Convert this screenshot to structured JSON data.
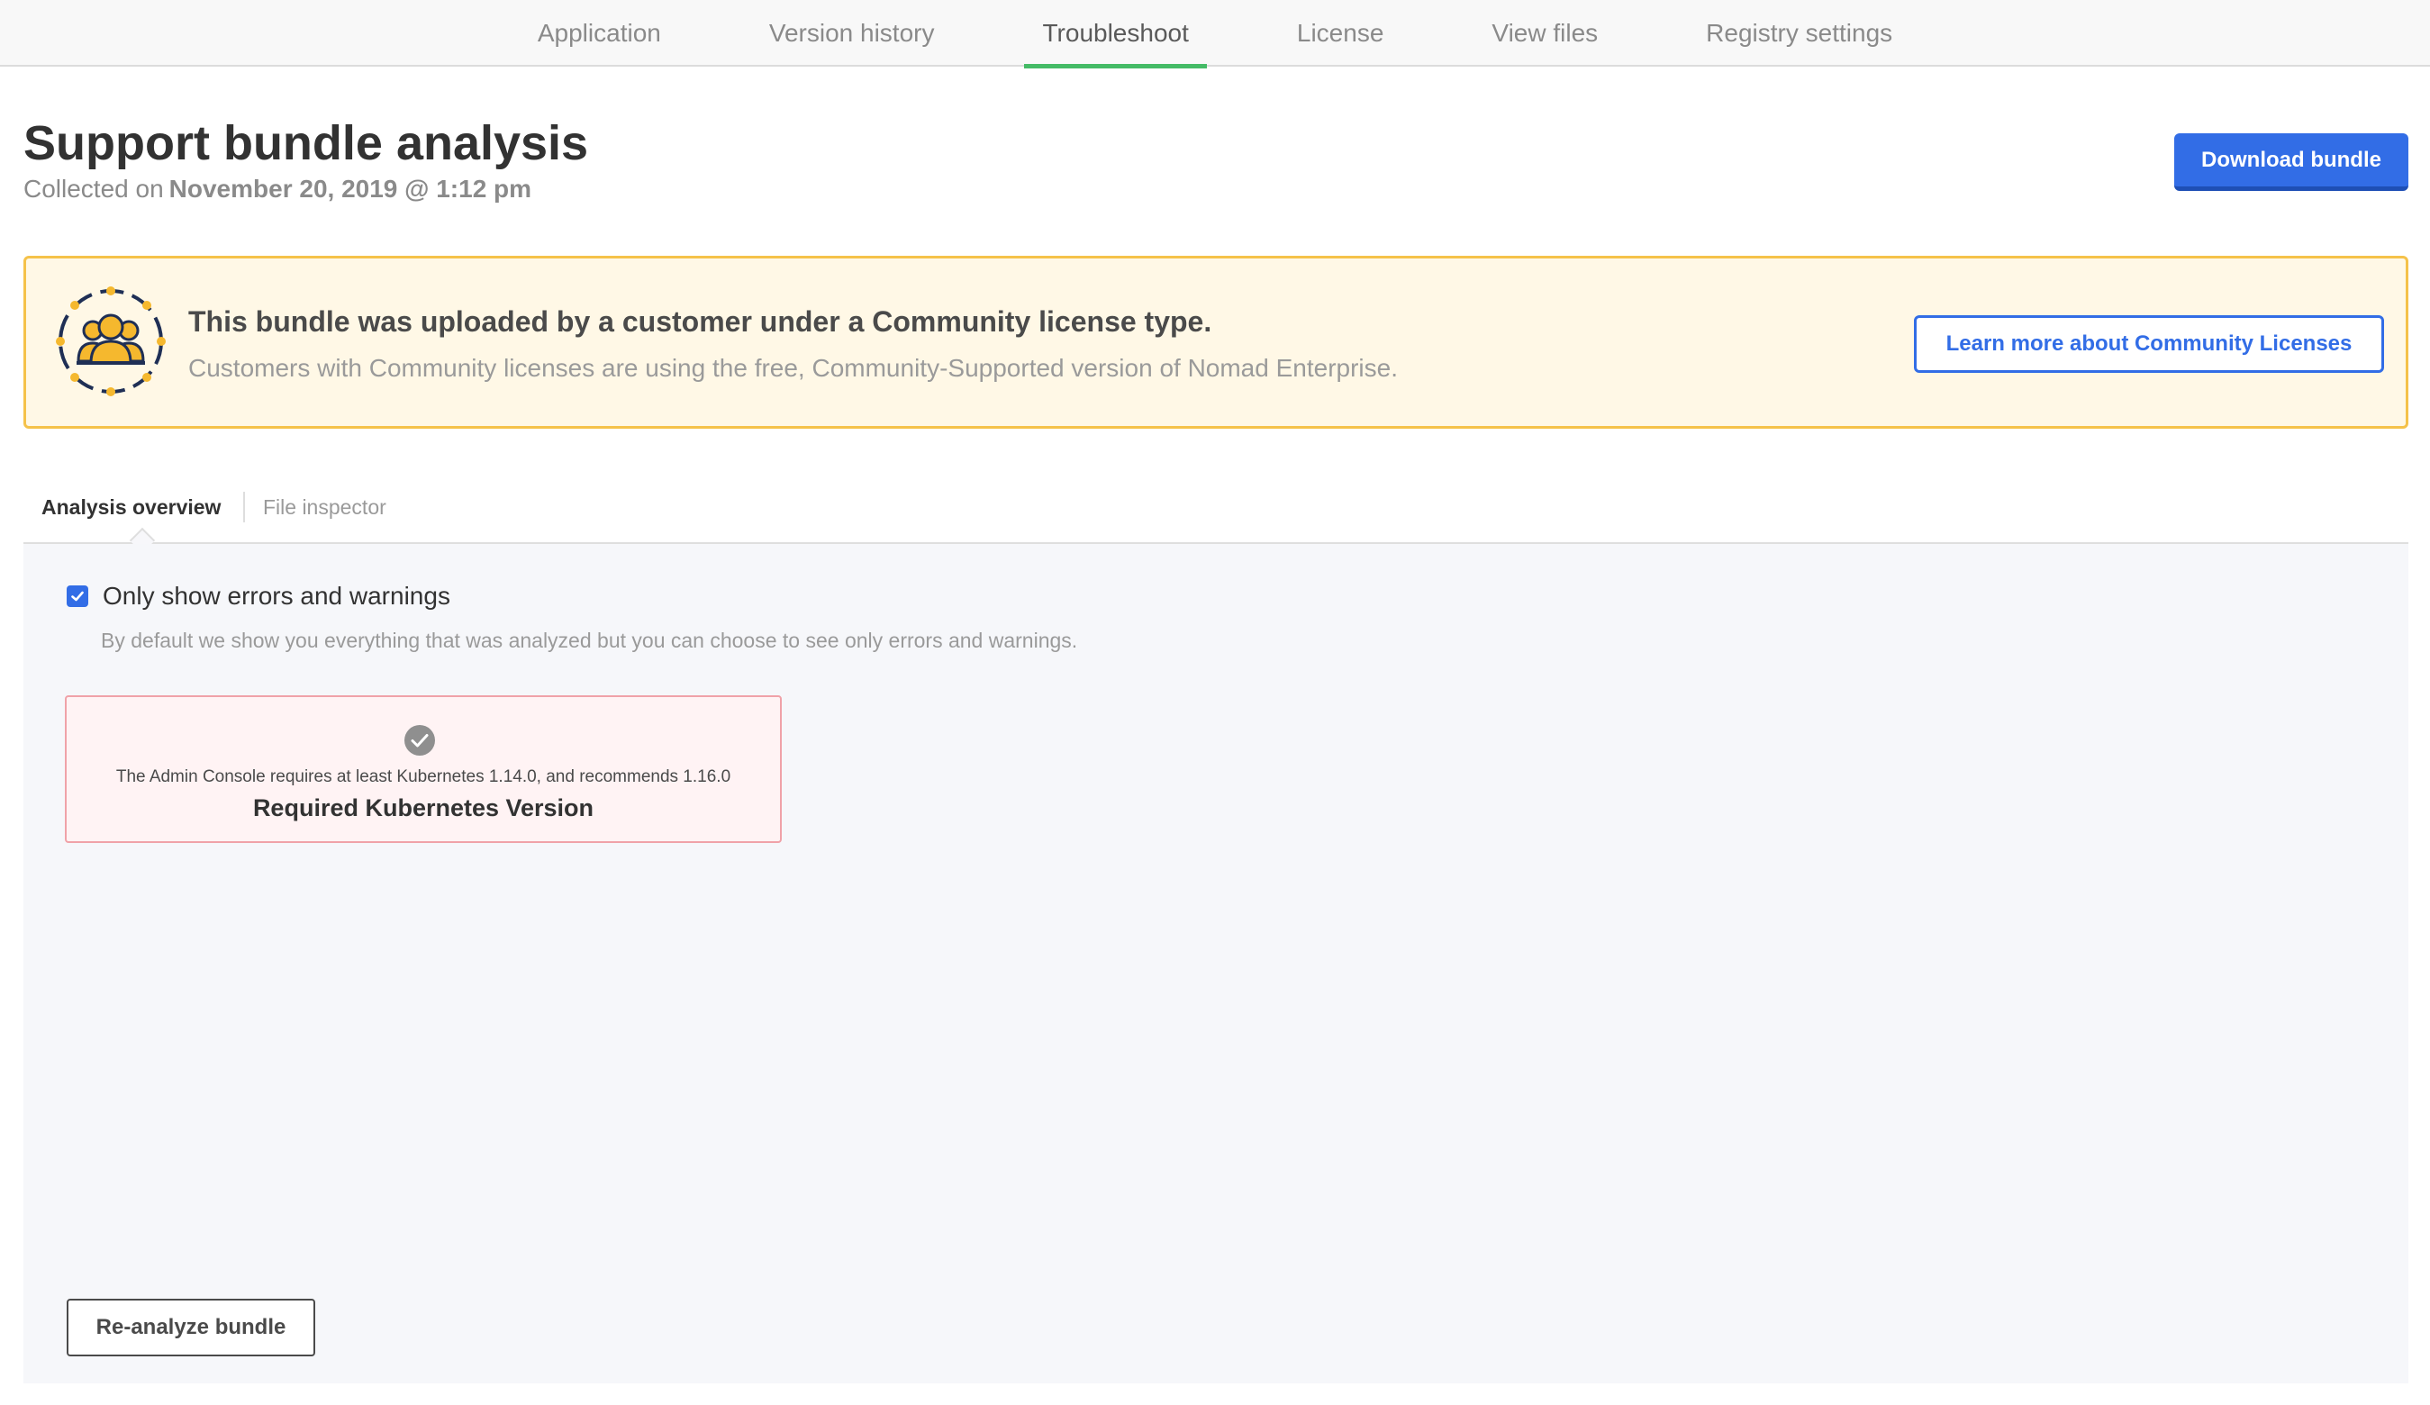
{
  "nav": {
    "tabs": [
      {
        "label": "Application"
      },
      {
        "label": "Version history"
      },
      {
        "label": "Troubleshoot"
      },
      {
        "label": "License"
      },
      {
        "label": "View files"
      },
      {
        "label": "Registry settings"
      }
    ],
    "active_tab": "Troubleshoot"
  },
  "header": {
    "title": "Support bundle analysis",
    "collected_prefix": "Collected on",
    "collected_date": "November 20, 2019 @ 1:12 pm",
    "download_label": "Download bundle"
  },
  "banner": {
    "icon": "community-users-icon",
    "title": "This bundle was uploaded by a customer under a Community license type.",
    "subtitle": "Customers with Community licenses are using the free, Community-Supported version of Nomad Enterprise.",
    "learn_more_label": "Learn more about Community Licenses"
  },
  "subtabs": {
    "items": [
      {
        "label": "Analysis overview"
      },
      {
        "label": "File inspector"
      }
    ],
    "active": "Analysis overview"
  },
  "analysis": {
    "filter_checked": true,
    "filter_label": "Only show errors and warnings",
    "filter_description": "By default we show you everything that was analyzed but you can choose to see only errors and warnings.",
    "insights": [
      {
        "icon": "check-circle-icon",
        "message": "The Admin Console requires at least Kubernetes 1.14.0, and recommends 1.16.0",
        "title": "Required Kubernetes Version"
      }
    ],
    "reanalyze_label": "Re-analyze bundle"
  },
  "colors": {
    "accent_blue": "#326de6",
    "active_tab_underline": "#44bb66",
    "banner_background": "#fff8e6",
    "banner_border": "#f5c24a",
    "insight_background": "#fff3f4",
    "insight_border": "#f0a2a8"
  }
}
